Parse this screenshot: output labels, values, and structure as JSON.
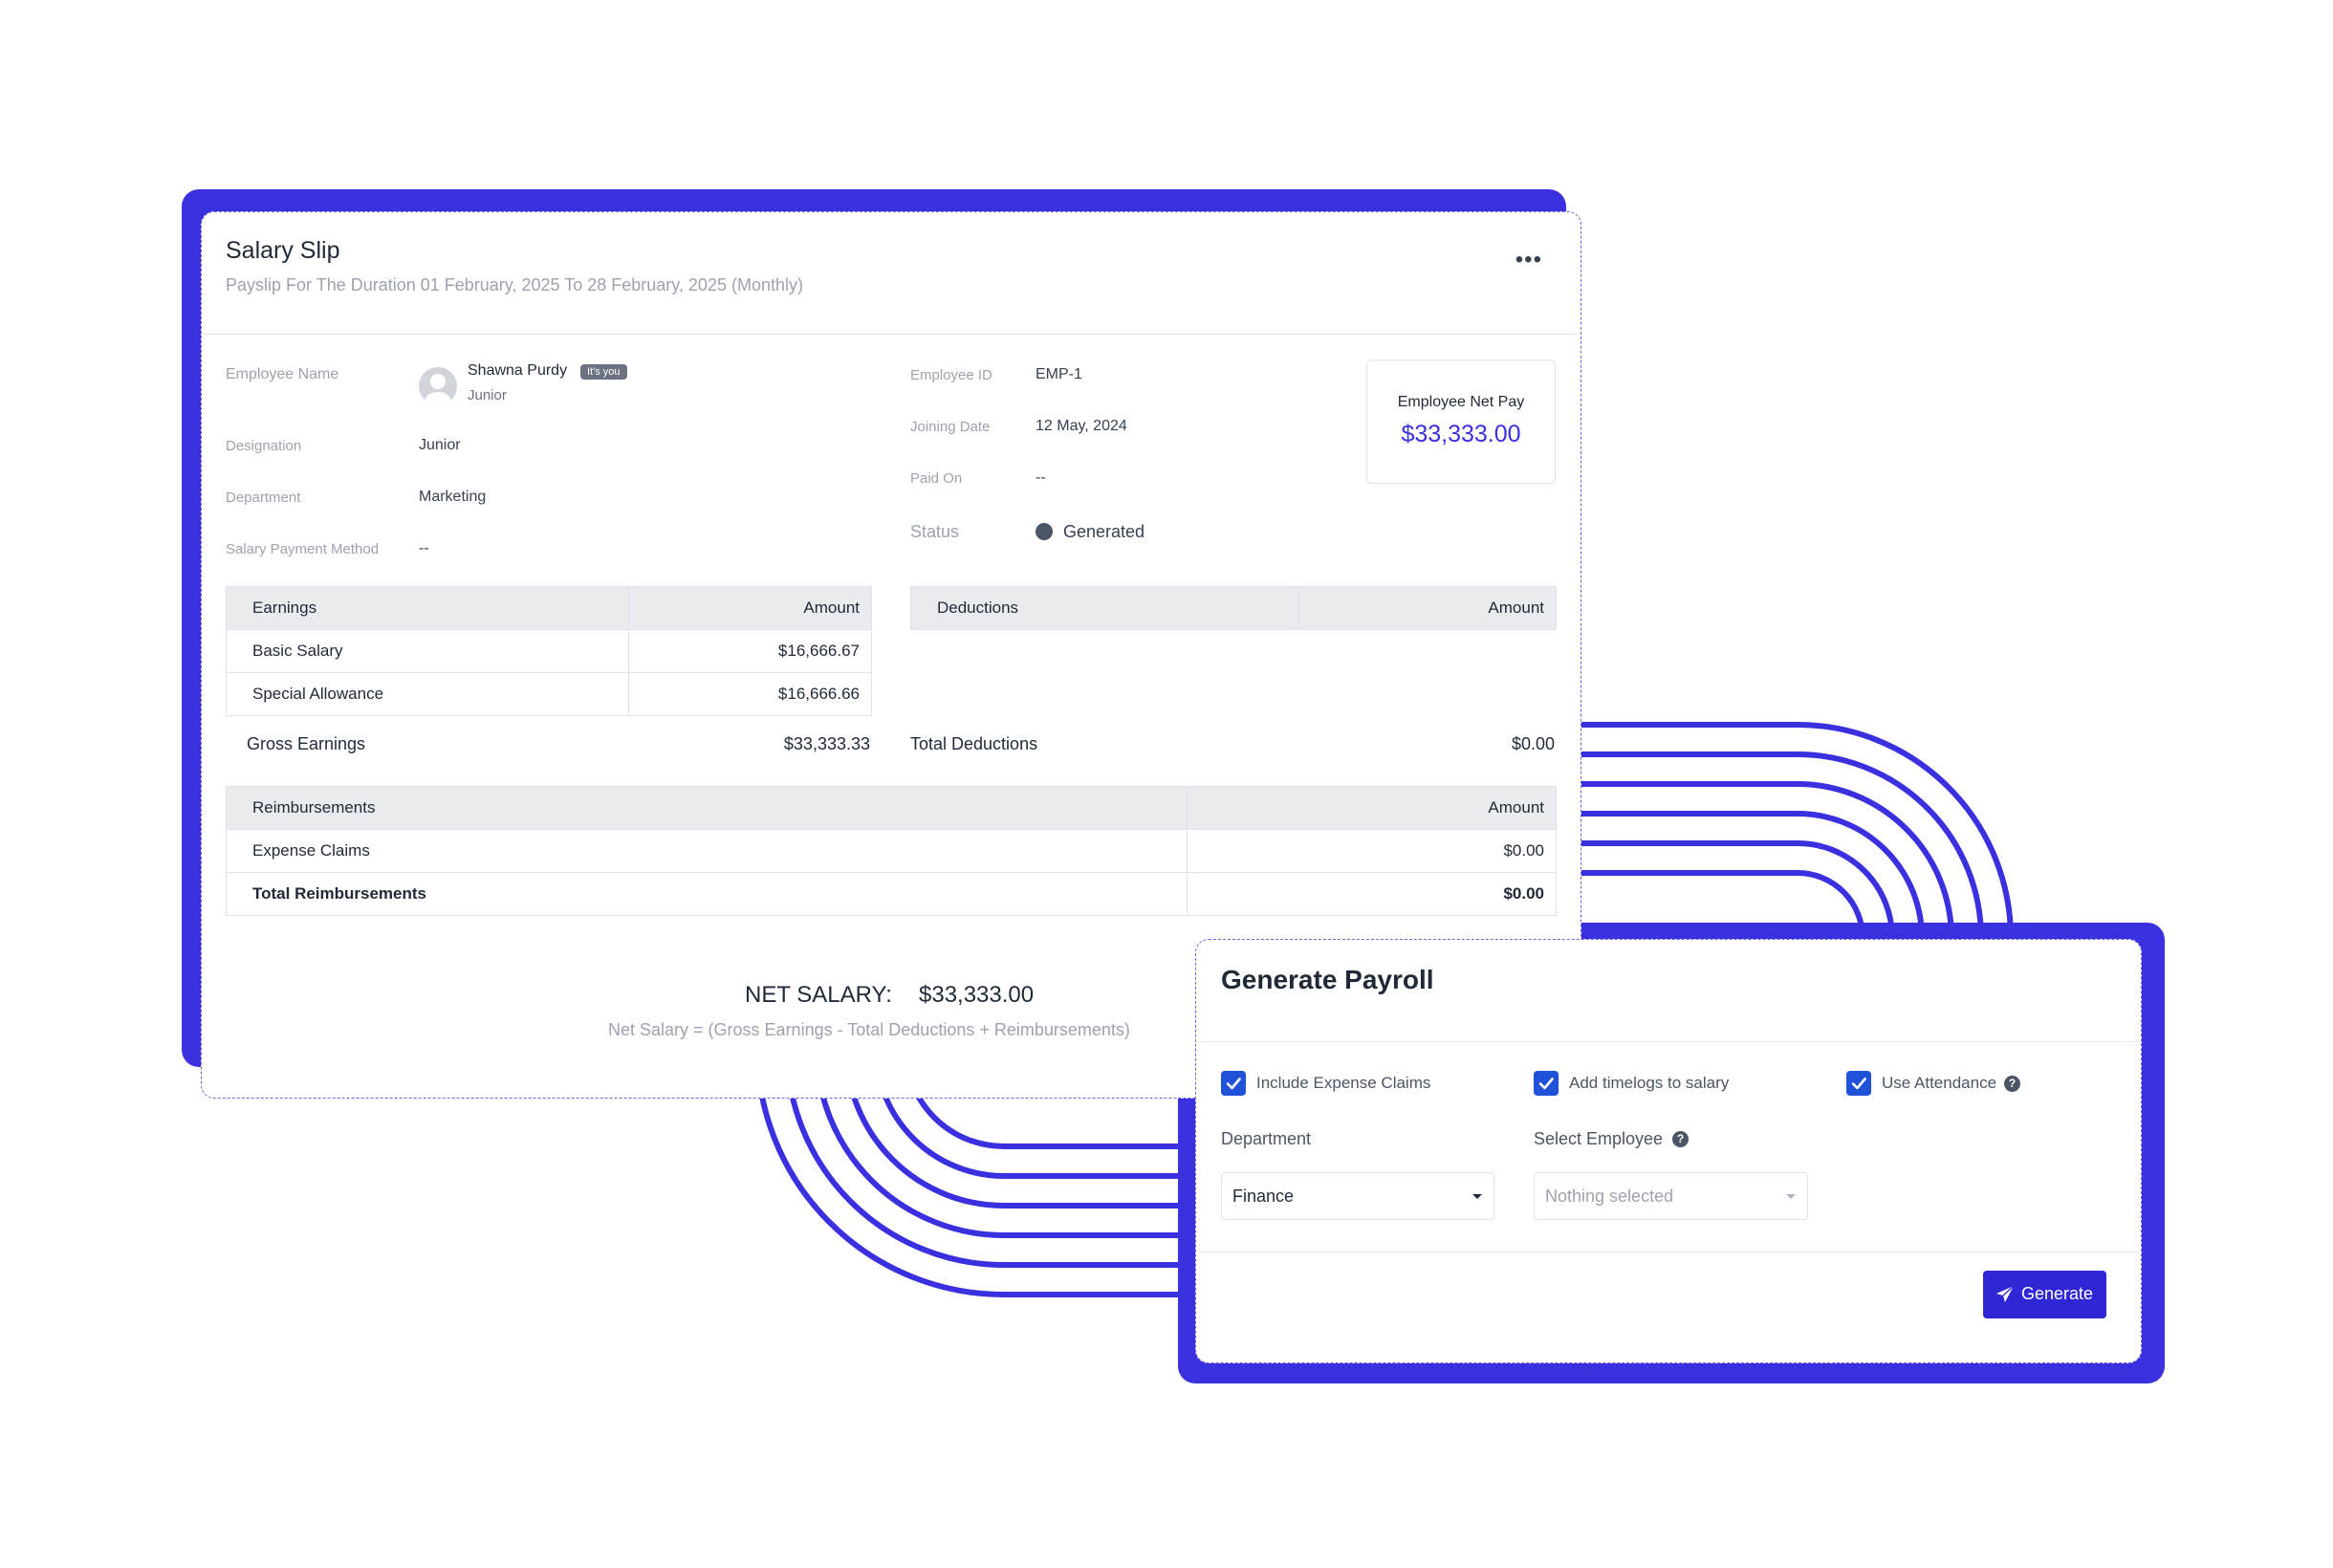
{
  "salary_slip": {
    "title": "Salary Slip",
    "subtitle": "Payslip For The Duration 01 February, 2025 To 28 February, 2025 (Monthly)",
    "menu_icon": "more-horizontal-icon",
    "employee": {
      "name_label": "Employee Name",
      "name": "Shawna Purdy",
      "badge": "It's you",
      "role": "Junior",
      "designation_label": "Designation",
      "designation": "Junior",
      "department_label": "Department",
      "department": "Marketing",
      "payment_method_label": "Salary Payment Method",
      "payment_method": "--",
      "id_label": "Employee ID",
      "id": "EMP-1",
      "joining_label": "Joining Date",
      "joining_date": "12 May, 2024",
      "paid_on_label": "Paid On",
      "paid_on": "--",
      "status_label": "Status",
      "status": "Generated"
    },
    "net_pay": {
      "label": "Employee Net Pay",
      "value": "$33,333.00"
    },
    "earnings": {
      "headers": [
        "Earnings",
        "Amount"
      ],
      "rows": [
        {
          "name": "Basic Salary",
          "amount": "$16,666.67"
        },
        {
          "name": "Special Allowance",
          "amount": "$16,666.66"
        }
      ],
      "total_label": "Gross Earnings",
      "total": "$33,333.33"
    },
    "deductions": {
      "headers": [
        "Deductions",
        "Amount"
      ],
      "total_label": "Total Deductions",
      "total": "$0.00"
    },
    "reimbursements": {
      "headers": [
        "Reimbursements",
        "Amount"
      ],
      "rows": [
        {
          "name": "Expense Claims",
          "amount": "$0.00"
        },
        {
          "name": "Total Reimbursements",
          "amount": "$0.00"
        }
      ]
    },
    "net_salary_label": "NET SALARY:",
    "net_salary": "$33,333.00",
    "formula": "Net Salary = (Gross Earnings - Total Deductions + Reimbursements)"
  },
  "generate_payroll": {
    "title": "Generate Payroll",
    "checkboxes": [
      {
        "label": "Include Expense Claims",
        "checked": true
      },
      {
        "label": "Add timelogs to salary",
        "checked": true
      },
      {
        "label": "Use Attendance",
        "checked": true
      }
    ],
    "department_label": "Department",
    "department_value": "Finance",
    "employee_label": "Select Employee",
    "employee_placeholder": "Nothing selected",
    "button_label": "Generate",
    "help_icon_glyph": "?"
  },
  "colors": {
    "accent": "#3b30e0",
    "checkbox": "#1f52d8",
    "button": "#2f26d6",
    "status_dot": "#4b5563"
  }
}
